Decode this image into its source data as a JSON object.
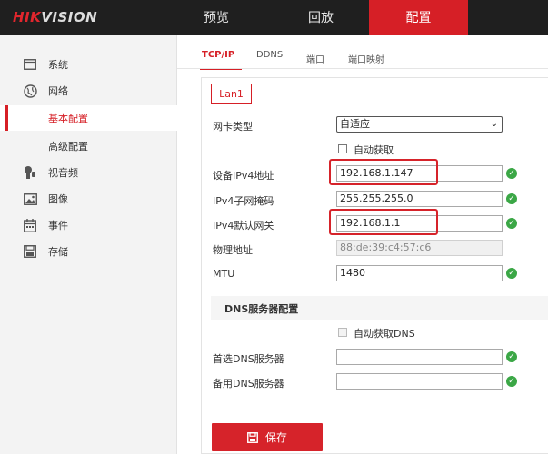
{
  "brand": {
    "hik": "HIK",
    "vision": "VISION"
  },
  "nav": [
    {
      "label": "预览"
    },
    {
      "label": "回放"
    },
    {
      "label": "配置"
    }
  ],
  "sidebar": {
    "items": [
      {
        "label": "系统",
        "icon": "monitor-icon"
      },
      {
        "label": "网络",
        "icon": "globe-icon"
      },
      {
        "label": "基本配置"
      },
      {
        "label": "高级配置"
      },
      {
        "label": "视音频",
        "icon": "audio-video-icon"
      },
      {
        "label": "图像",
        "icon": "image-icon"
      },
      {
        "label": "事件",
        "icon": "calendar-icon"
      },
      {
        "label": "存储",
        "icon": "storage-icon"
      }
    ]
  },
  "tabs": [
    {
      "label": "TCP/IP"
    },
    {
      "label": "DDNS"
    },
    {
      "label": "端口"
    },
    {
      "label": "端口映射"
    }
  ],
  "subtab": "Lan1",
  "form": {
    "nic_type": {
      "label": "网卡类型",
      "value": "自适应"
    },
    "dhcp": {
      "label": "自动获取"
    },
    "ipv4_address": {
      "label": "设备IPv4地址",
      "value": "192.168.1.147"
    },
    "ipv4_mask": {
      "label": "IPv4子网掩码",
      "value": "255.255.255.0"
    },
    "ipv4_gateway": {
      "label": "IPv4默认网关",
      "value": "192.168.1.1"
    },
    "mac": {
      "label": "物理地址",
      "value": "88:de:39:c4:57:c6"
    },
    "mtu": {
      "label": "MTU",
      "value": "1480"
    }
  },
  "dns": {
    "section_title": "DNS服务器配置",
    "auto_dns": {
      "label": "自动获取DNS"
    },
    "preferred": {
      "label": "首选DNS服务器",
      "value": ""
    },
    "alternate": {
      "label": "备用DNS服务器",
      "value": ""
    }
  },
  "save_label": "保存",
  "colors": {
    "accent": "#d61f26",
    "ok": "#3ba746",
    "topbar": "#1f1f1f"
  }
}
